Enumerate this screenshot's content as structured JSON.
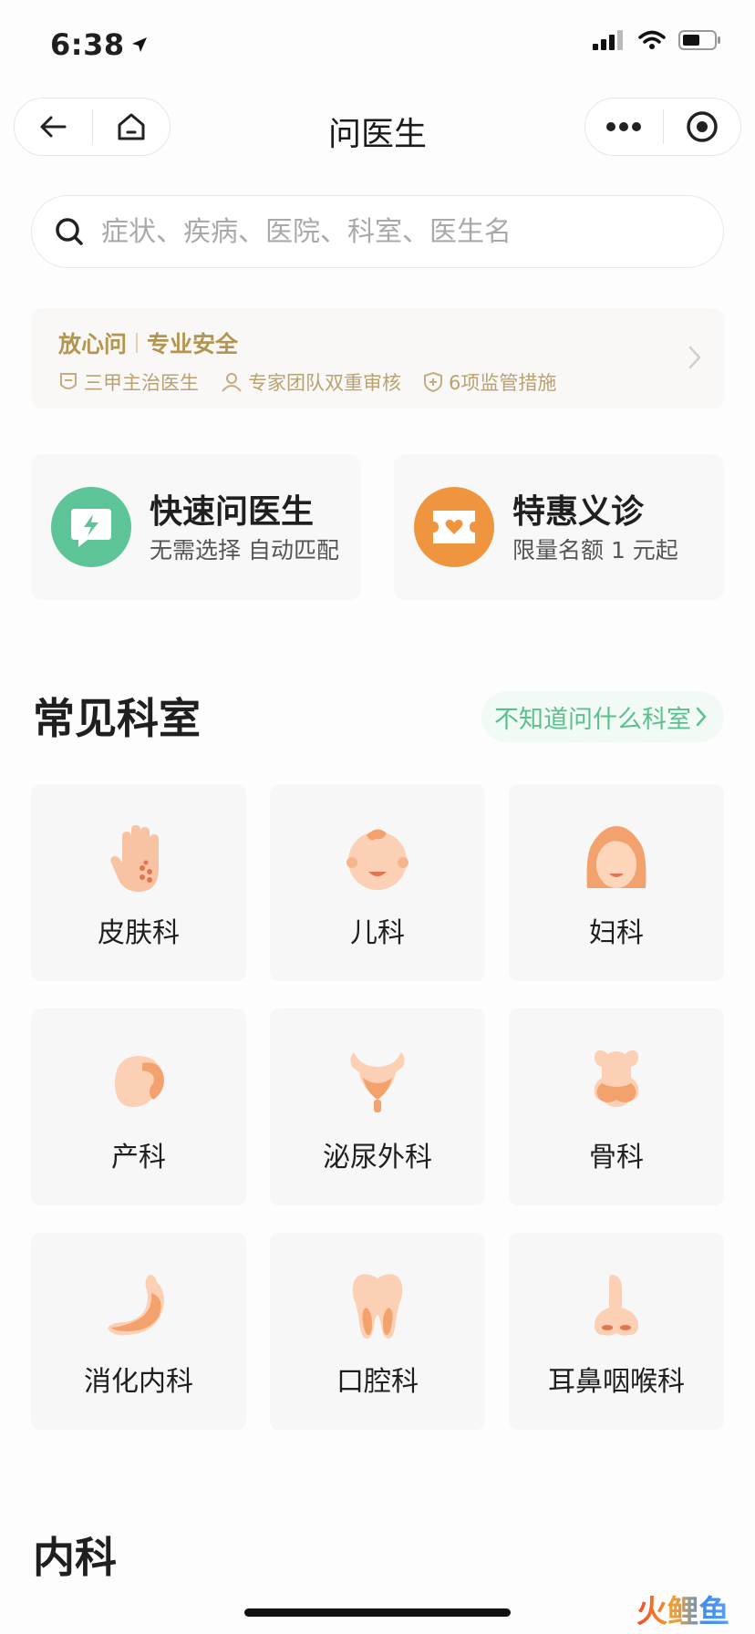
{
  "status_bar": {
    "time": "6:38"
  },
  "nav": {
    "title": "问医生"
  },
  "search": {
    "placeholder": "症状、疾病、医院、科室、医生名"
  },
  "trust": {
    "title_a": "放心问",
    "title_b": "专业安全",
    "items": [
      "三甲主治医生",
      "专家团队双重审核",
      "6项监管措施"
    ]
  },
  "features": [
    {
      "title": "快速问医生",
      "subtitle": "无需选择 自动匹配",
      "color": "#5cc497"
    },
    {
      "title": "特惠义诊",
      "subtitle": "限量名额 1 元起",
      "color": "#f0953f"
    }
  ],
  "common": {
    "title": "常见科室",
    "hint": "不知道问什么科室",
    "departments": [
      {
        "label": "皮肤科",
        "icon": "hand-icon"
      },
      {
        "label": "儿科",
        "icon": "baby-icon"
      },
      {
        "label": "妇科",
        "icon": "woman-icon"
      },
      {
        "label": "产科",
        "icon": "pregnancy-icon"
      },
      {
        "label": "泌尿外科",
        "icon": "bladder-icon"
      },
      {
        "label": "骨科",
        "icon": "bone-icon"
      },
      {
        "label": "消化内科",
        "icon": "stomach-icon"
      },
      {
        "label": "口腔科",
        "icon": "tooth-icon"
      },
      {
        "label": "耳鼻咽喉科",
        "icon": "nose-icon"
      }
    ]
  },
  "section_next": {
    "title": "内科"
  },
  "watermark": {
    "text": "火鲤鱼"
  },
  "colors": {
    "accent_green": "#5cc497",
    "accent_orange": "#f0953f",
    "gold": "#b3954f",
    "peach": "#f7b08a"
  }
}
